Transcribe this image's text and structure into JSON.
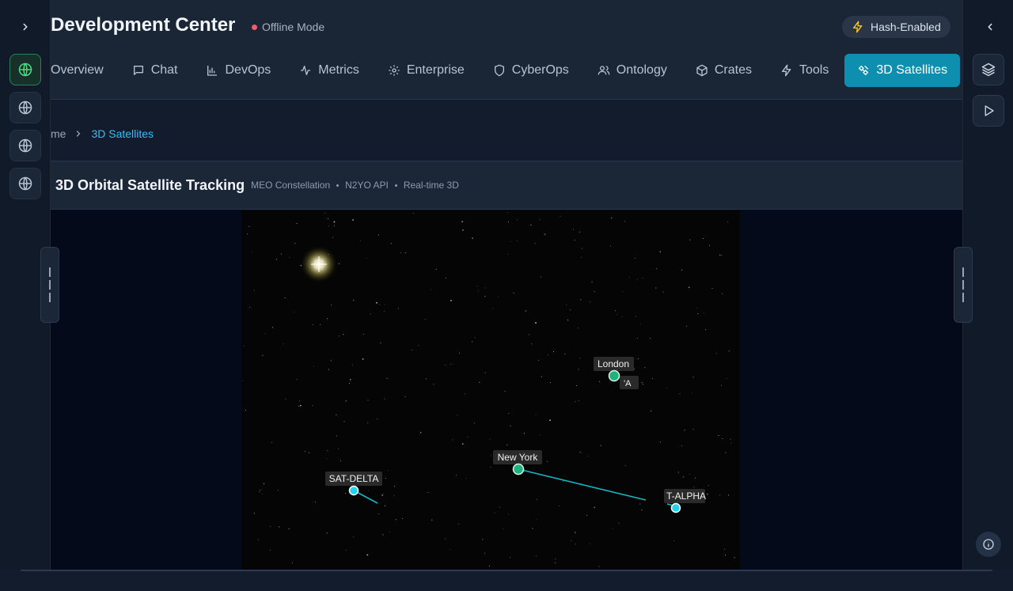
{
  "header": {
    "title": "Development Center",
    "status": "Offline Mode",
    "badge": "Hash-Enabled"
  },
  "tabs": [
    {
      "label": "Overview",
      "icon": "none"
    },
    {
      "label": "Chat",
      "icon": "chat-icon"
    },
    {
      "label": "DevOps",
      "icon": "bar-chart-icon"
    },
    {
      "label": "Metrics",
      "icon": "activity-icon"
    },
    {
      "label": "Enterprise",
      "icon": "gear-icon"
    },
    {
      "label": "CyberOps",
      "icon": "shield-icon"
    },
    {
      "label": "Ontology",
      "icon": "users-icon"
    },
    {
      "label": "Crates",
      "icon": "box-icon"
    },
    {
      "label": "Tools",
      "icon": "bolt-icon"
    },
    {
      "label": "3D Satellites",
      "icon": "satellite-icon",
      "active": true
    }
  ],
  "breadcrumb": {
    "parent": "me",
    "current": "3D Satellites"
  },
  "panel": {
    "title": "3D Orbital Satellite Tracking",
    "meta": [
      "MEO Constellation",
      "N2YO API",
      "Real-time 3D"
    ]
  },
  "scene": {
    "labels": {
      "london": "London",
      "london_overlap": "'A",
      "new_york": "New York",
      "sat_delta": "SAT-DELTA",
      "sat_alpha": "T-ALPHA"
    }
  },
  "colors": {
    "accent": "#0e8fb0",
    "active_link": "#38bdf8",
    "offline_dot": "#f25c6a",
    "ground_station": "#22b07d",
    "satellite": "#22d3ee"
  },
  "left_rail": [
    "globe-icon",
    "globe-icon",
    "globe-icon",
    "globe-icon"
  ],
  "right_rail": [
    "layers-icon",
    "play-icon",
    "info-icon"
  ]
}
